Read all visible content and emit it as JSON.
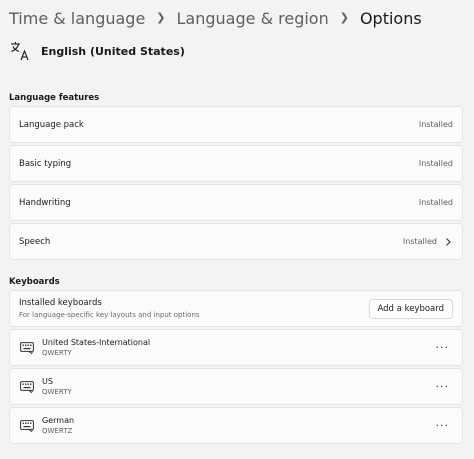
{
  "breadcrumb": {
    "items": [
      "Time & language",
      "Language & region"
    ],
    "current": "Options"
  },
  "language": {
    "name": "English (United States)",
    "icon": "language-icon"
  },
  "language_features": {
    "title": "Language features",
    "rows": [
      {
        "label": "Language pack",
        "status": "Installed"
      },
      {
        "label": "Basic typing",
        "status": "Installed"
      },
      {
        "label": "Handwriting",
        "status": "Installed"
      },
      {
        "label": "Speech",
        "status": "Installed",
        "has_chevron": true
      }
    ]
  },
  "keyboards": {
    "title": "Keyboards",
    "installed": {
      "title": "Installed keyboards",
      "subtitle": "For language-specific key layouts and input options",
      "add_button": "Add a keyboard"
    },
    "items": [
      {
        "name": "United States-International",
        "layout": "QWERTY",
        "icon": "keyboard-icon"
      },
      {
        "name": "US",
        "layout": "QWERTY",
        "icon": "keyboard-icon"
      },
      {
        "name": "German",
        "layout": "QWERTZ",
        "icon": "keyboard-icon"
      }
    ],
    "more_label": "···"
  },
  "colors": {
    "background": "#f3f3f3",
    "card": "#fbfbfb",
    "border": "#e5e5e5",
    "text": "#1a1a1a",
    "secondary_text": "#5f5f5f"
  }
}
